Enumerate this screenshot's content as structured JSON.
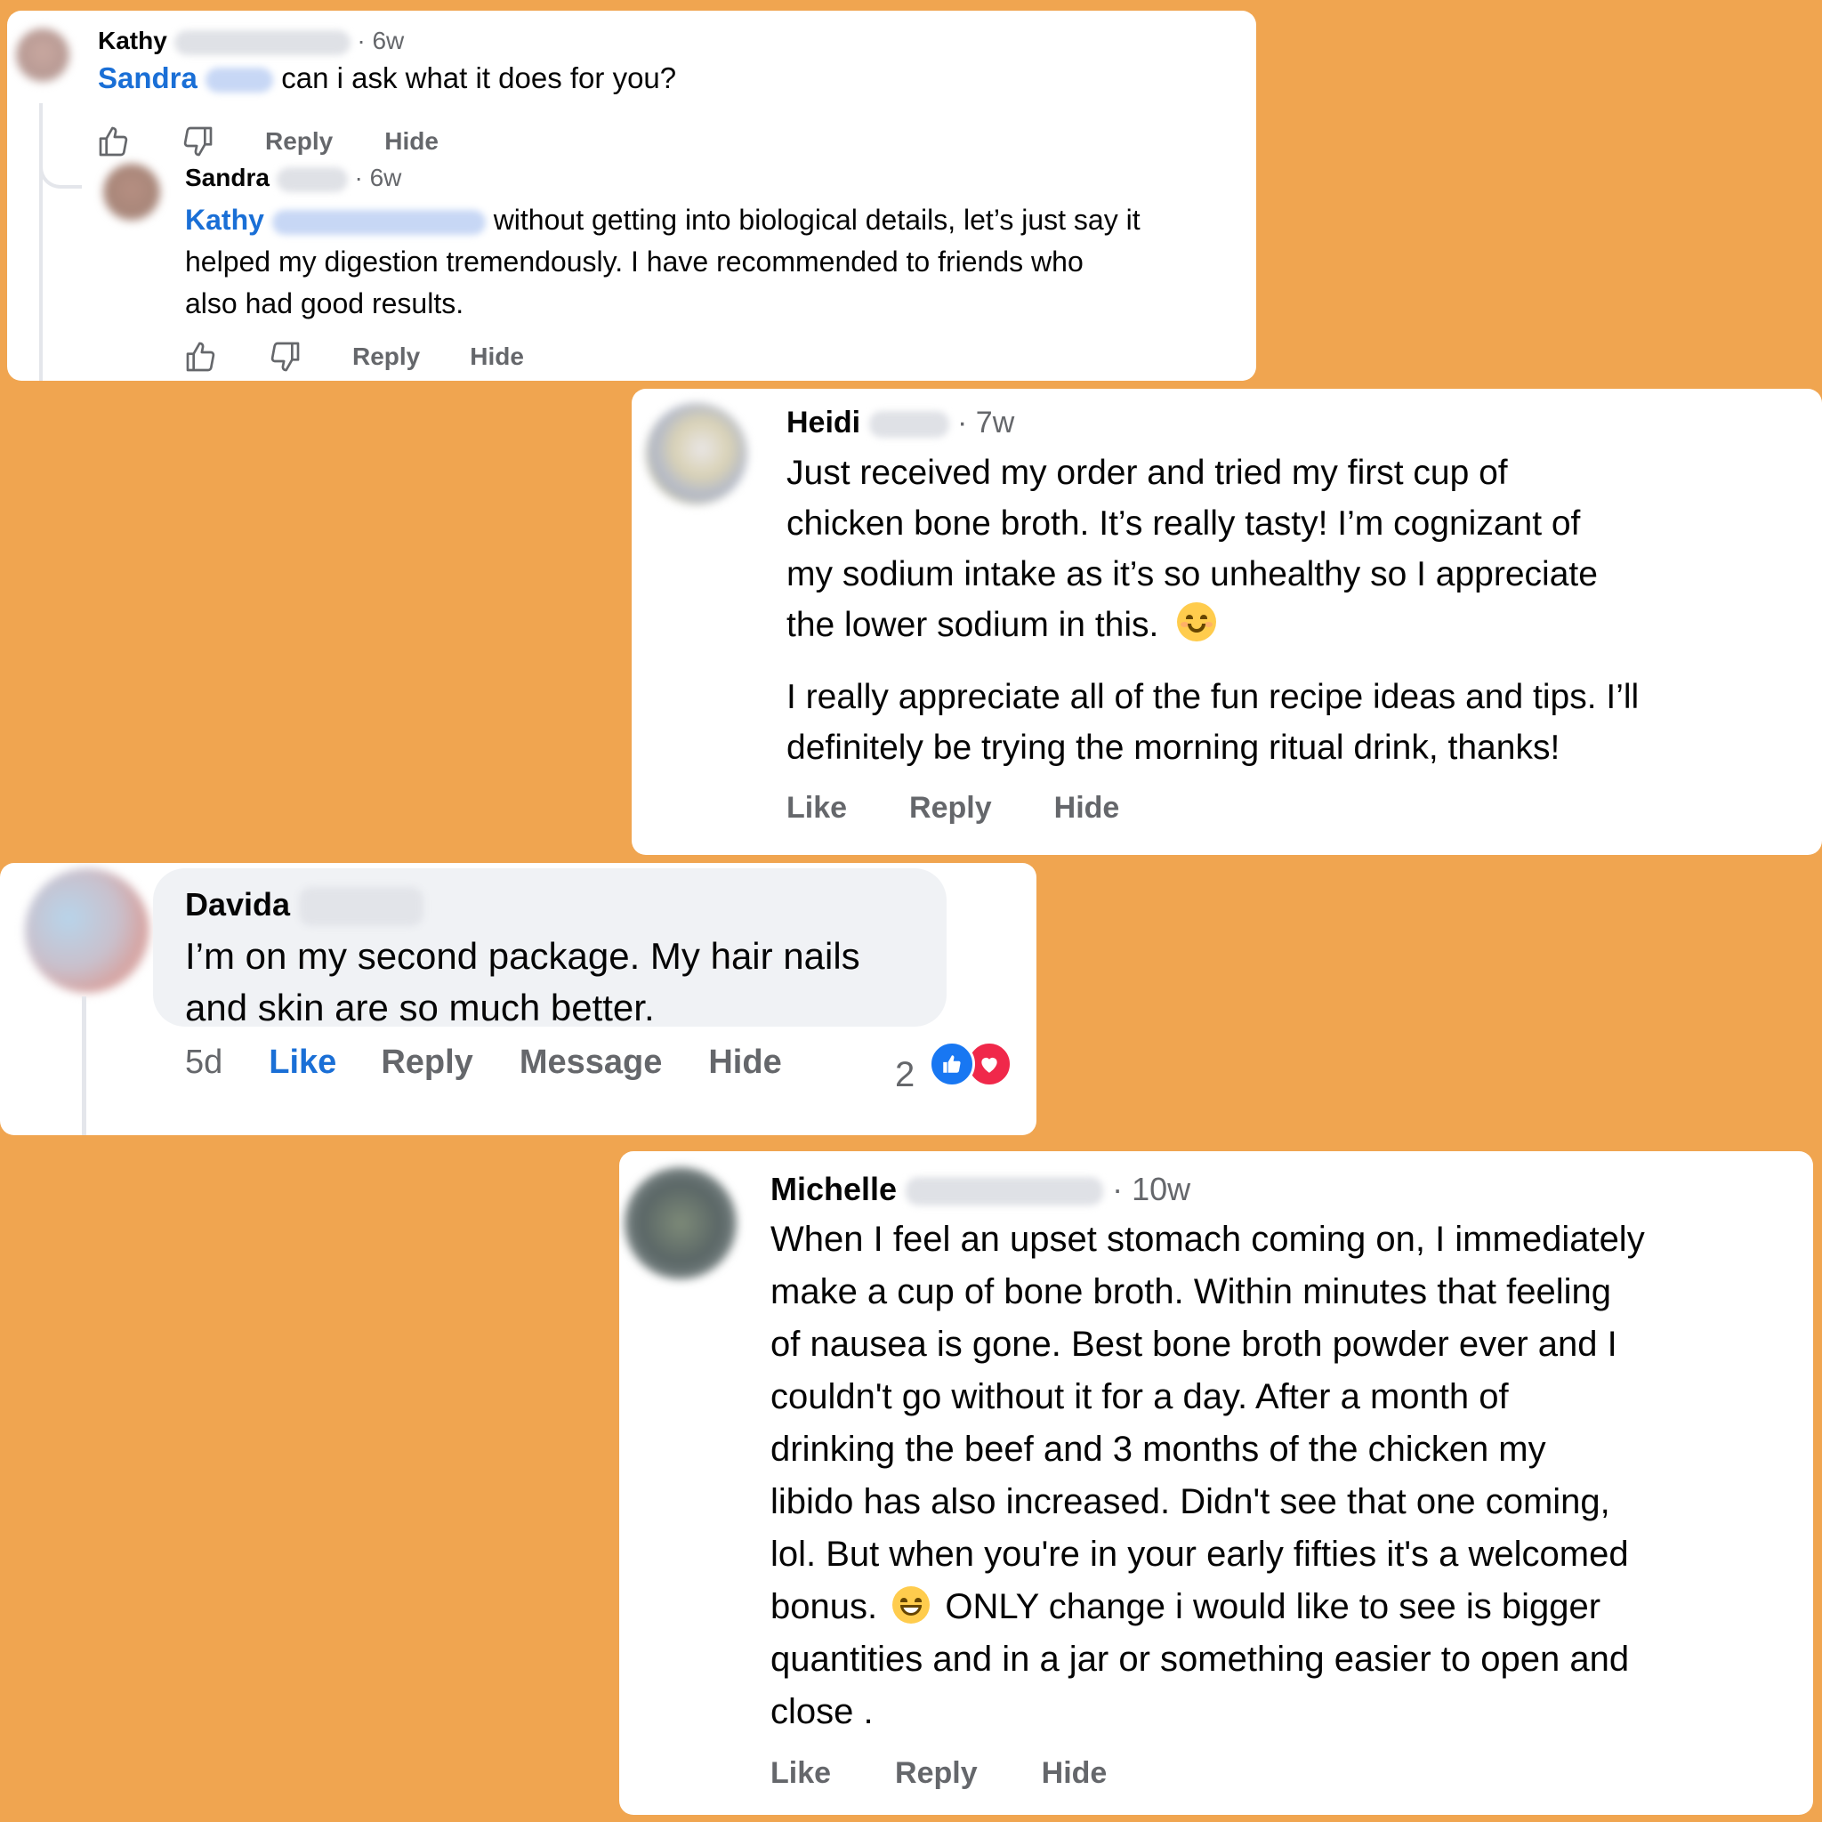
{
  "card1": {
    "comment": {
      "author": "Kathy",
      "time": "· 6w",
      "mention": "Sandra",
      "text": "can i ask what it does for you?",
      "reply_label": "Reply",
      "hide_label": "Hide"
    },
    "reply": {
      "author": "Sandra",
      "time": "· 6w",
      "mention": "Kathy",
      "line1": "without getting into biological details, let’s just say it",
      "line2": "helped my digestion tremendously. I have recommended to friends who",
      "line3": "also had good results.",
      "reply_label": "Reply",
      "hide_label": "Hide"
    }
  },
  "card2": {
    "author": "Heidi",
    "time": "· 7w",
    "para1": [
      "Just received my order and tried my first cup of",
      "chicken bone broth. It’s really tasty! I’m cognizant of",
      "my sodium intake as it’s so unhealthy so I appreciate",
      "the lower sodium in this."
    ],
    "para2": [
      "I really appreciate all of the fun recipe ideas and tips. I’ll",
      "definitely be trying the morning ritual drink, thanks!"
    ],
    "like_label": "Like",
    "reply_label": "Reply",
    "hide_label": "Hide"
  },
  "card3": {
    "author": "Davida",
    "line1": "I’m on my second package. My hair nails",
    "line2": "and skin are so much better.",
    "time": "5d",
    "like_label": "Like",
    "reply_label": "Reply",
    "message_label": "Message",
    "hide_label": "Hide",
    "reaction_count": "2"
  },
  "card4": {
    "author": "Michelle",
    "time": "· 10w",
    "lines": [
      "When I feel an upset stomach coming on, I immediately",
      "make a cup of bone broth. Within minutes that feeling",
      "of nausea is gone. Best bone broth powder ever and I",
      "couldn't go without it for a day. After a month of",
      "drinking the beef and 3 months of the chicken my",
      "libido has also increased. Didn't see that one coming,",
      "lol. But when you're in your early fifties it's a welcomed"
    ],
    "line8_a": "bonus.",
    "line8_b": "ONLY change i would like to see is bigger",
    "line9": "quantities and in a jar or something easier to open and",
    "line10": "close .",
    "like_label": "Like",
    "reply_label": "Reply",
    "hide_label": "Hide"
  },
  "colors": {
    "background": "#F0A550",
    "mention": "#1a6fd6",
    "like_active": "#1a6fd6",
    "muted": "#65676b"
  },
  "icons": [
    "thumbs-up-icon",
    "thumbs-down-icon",
    "like-reaction-icon",
    "love-reaction-icon",
    "smiling-emoji",
    "grinning-emoji"
  ]
}
